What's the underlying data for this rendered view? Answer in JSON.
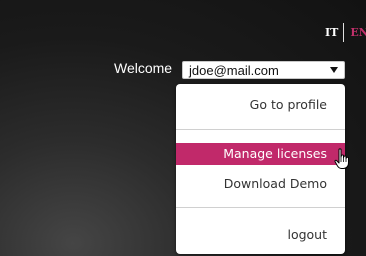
{
  "language": {
    "it": "IT",
    "en": "EN",
    "active": "EN"
  },
  "header": {
    "welcome_label": "Welcome"
  },
  "account_select": {
    "value": "jdoe@mail.com"
  },
  "menu": {
    "items": [
      {
        "label": "Go to profile"
      },
      {
        "label": "Manage licenses",
        "active": true
      },
      {
        "label": "Download Demo"
      },
      {
        "label": "logout"
      }
    ]
  },
  "colors": {
    "accent": "#c1296a",
    "background": "#1a1a1a"
  },
  "icons": {
    "cursor": "hand-pointer-icon"
  }
}
